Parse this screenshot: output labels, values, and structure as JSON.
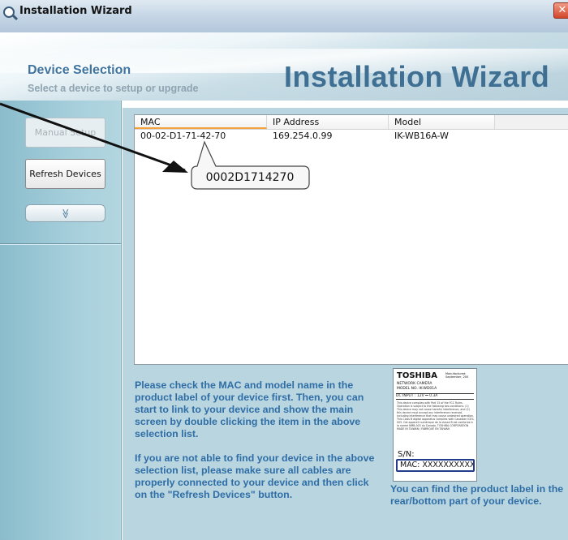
{
  "window": {
    "title": "Installation Wizard",
    "close_glyph": "✕"
  },
  "header": {
    "title": "Device Selection",
    "subtitle": "Select a device to setup or upgrade",
    "brand": "Installation Wizard"
  },
  "sidebar": {
    "manual_setup_label": "Manual Setup",
    "refresh_label": "Refresh Devices",
    "more_glyph": "≫"
  },
  "device_list": {
    "columns": [
      "MAC",
      "IP Address",
      "Model",
      ""
    ],
    "rows": [
      {
        "mac": "00-02-D1-71-42-70",
        "ip": "169.254.0.99",
        "model": "IK-WB16A-W"
      }
    ]
  },
  "instructions": {
    "paragraph1": "Please check the MAC and model name in the product label of your device first. Then, you can start to link to your device and show the main screen by double clicking the item in the above selection list.",
    "paragraph2": "If you are not able to find your device in the above selection list, please make sure all cables are properly connected to your device and then click on the \"Refresh Devices\" button."
  },
  "product_label": {
    "brand": "TOSHIBA",
    "manufactured": "Manufactured: September, 200",
    "line1": "NETWORK CAMERA",
    "line2": "MODEL NO. IK-WD01A",
    "dc_input": "DC INPUT : 12V ⎓ 0.3A",
    "compliance_text": "This device complies with Part 15 of the FCC Rules. Operation is subject to the following two conditions: (1) This device may not cause harmful interference, and (2) this device must accept any interference received, including interference that may cause undesired operation. This Class B digital apparatus complies with Canadian ICES-003. Cet appareil numérique de la classe B est conforme à la norme NMB-003 du Canada. TOSHIBA CORPORATION MADE IN TAIWAN / FABRIQUÉ EN TAIWAN",
    "sn_label": "S/N:",
    "mac_label": "MAC: XXXXXXXXXXXX"
  },
  "label_caption": "You can find the product label in the rear/bottom part of your device.",
  "callout": {
    "text": "0002D1714270"
  },
  "colors": {
    "accent_text": "#2f6da6",
    "sidebar_bg": "#a6cfdb",
    "brand_text": "#3f6f92"
  }
}
